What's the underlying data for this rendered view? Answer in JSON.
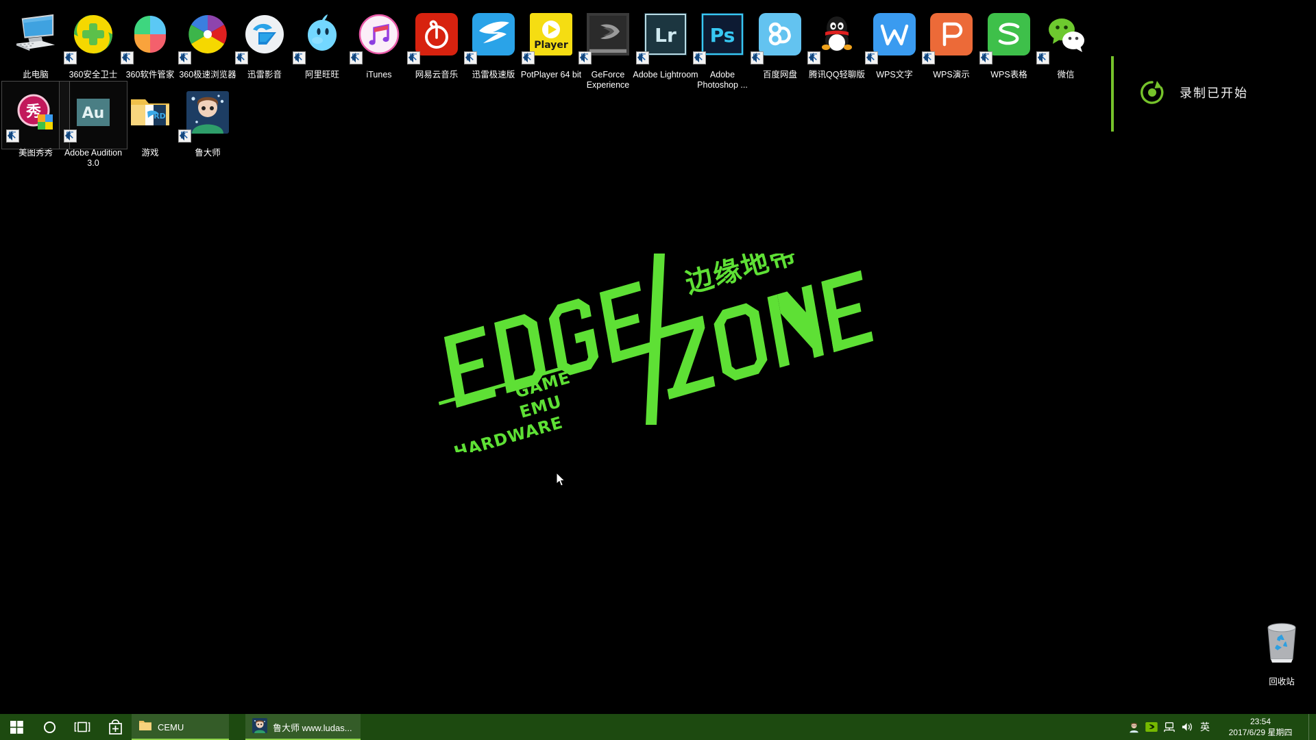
{
  "desktop": {
    "background_color": "#000000",
    "icons_row1": [
      {
        "label": "此电脑",
        "icon": "computer-icon",
        "shortcut": false
      },
      {
        "label": "360安全卫士",
        "icon": "360-safe-icon",
        "shortcut": true
      },
      {
        "label": "360软件管家",
        "icon": "360-software-manager-icon",
        "shortcut": true
      },
      {
        "label": "360极速浏览器",
        "icon": "360-browser-icon",
        "shortcut": true
      },
      {
        "label": "迅雷影音",
        "icon": "xunlei-player-icon",
        "shortcut": true
      },
      {
        "label": "阿里旺旺",
        "icon": "aliwangwang-icon",
        "shortcut": true
      },
      {
        "label": "iTunes",
        "icon": "itunes-icon",
        "shortcut": true
      },
      {
        "label": "网易云音乐",
        "icon": "netease-music-icon",
        "shortcut": true
      },
      {
        "label": "迅雷极速版",
        "icon": "xunlei-speed-icon",
        "shortcut": true
      },
      {
        "label": "PotPlayer 64 bit",
        "icon": "potplayer-icon",
        "shortcut": true
      },
      {
        "label": "GeForce Experience",
        "icon": "geforce-experience-icon",
        "shortcut": true
      },
      {
        "label": "Adobe Lightroom",
        "icon": "adobe-lightroom-icon",
        "shortcut": true
      },
      {
        "label": "Adobe Photoshop ...",
        "icon": "adobe-photoshop-icon",
        "shortcut": true
      },
      {
        "label": "百度网盘",
        "icon": "baidu-netdisk-icon",
        "shortcut": true
      },
      {
        "label": "腾讯QQ轻聊版",
        "icon": "tencent-qq-icon",
        "shortcut": true
      },
      {
        "label": "WPS文字",
        "icon": "wps-writer-icon",
        "shortcut": true
      },
      {
        "label": "WPS演示",
        "icon": "wps-presentation-icon",
        "shortcut": true
      },
      {
        "label": "WPS表格",
        "icon": "wps-spreadsheet-icon",
        "shortcut": true
      },
      {
        "label": "微信",
        "icon": "wechat-icon",
        "shortcut": true
      }
    ],
    "icons_row2": [
      {
        "label": "美图秀秀",
        "icon": "meitu-xiuxiu-icon",
        "shortcut": true,
        "selected": true
      },
      {
        "label": "Adobe Audition 3.0",
        "icon": "adobe-audition-icon",
        "shortcut": true,
        "selected": true
      },
      {
        "label": "游戏",
        "icon": "folder-icon",
        "shortcut": false,
        "selected": false
      },
      {
        "label": "鲁大师",
        "icon": "ludashi-icon",
        "shortcut": true,
        "selected": false
      }
    ],
    "recycle_bin": {
      "label": "回收站",
      "icon": "recycle-bin-icon"
    }
  },
  "notification": {
    "text": "录制已开始",
    "icon": "record-started-icon",
    "accent_color": "#76c32b"
  },
  "logo": {
    "line1": "EDGE",
    "line2": "ZONE",
    "chinese": "边缘地带",
    "tag1": "GAME",
    "tag2": "EMU",
    "tag3": "HARDWARE",
    "color": "#5ee035"
  },
  "taskbar": {
    "background_color": "#1d4a10",
    "start": {
      "name": "start-button",
      "icon": "windows-logo-icon"
    },
    "cortana": {
      "name": "cortana-button",
      "icon": "cortana-circle-icon"
    },
    "taskview": {
      "name": "task-view-button",
      "icon": "task-view-icon"
    },
    "pinned": [
      {
        "label": "Microsoft Store",
        "icon": "store-icon"
      }
    ],
    "tasks": [
      {
        "label": "CEMU",
        "icon": "folder-icon",
        "active": true
      },
      {
        "label": "鲁大师 www.ludas...",
        "icon": "ludashi-icon",
        "active": true
      }
    ],
    "tray": {
      "icons": [
        {
          "name": "ludashi-tray-icon"
        },
        {
          "name": "nvidia-tray-icon"
        },
        {
          "name": "network-tray-icon"
        },
        {
          "name": "volume-tray-icon"
        }
      ],
      "ime": "英",
      "clock_time": "23:54",
      "clock_date": "2017/6/29 星期四"
    }
  }
}
